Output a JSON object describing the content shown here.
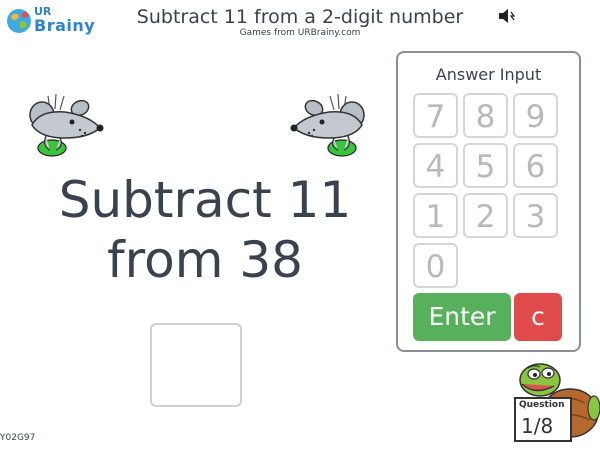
{
  "header": {
    "logo_top": "UR",
    "logo_bottom": "Brainy",
    "title": "Subtract 11 from a 2-digit number",
    "subtitle": "Games from URBrainy.com",
    "sound_icon": "speaker-mute-icon"
  },
  "question": {
    "line1": "Subtract 11",
    "line2": "from 38",
    "answer_value": ""
  },
  "keypad": {
    "title": "Answer Input",
    "keys": [
      "7",
      "8",
      "9",
      "4",
      "5",
      "6",
      "1",
      "2",
      "3",
      "0"
    ],
    "enter_label": "Enter",
    "clear_label": "c"
  },
  "counter": {
    "label": "Question",
    "value": "1/8"
  },
  "footer": {
    "code": "Y02G97"
  },
  "colors": {
    "enter": "#57b05b",
    "clear": "#e04a4a",
    "text": "#3a4250",
    "logo": "#2f83c8"
  }
}
